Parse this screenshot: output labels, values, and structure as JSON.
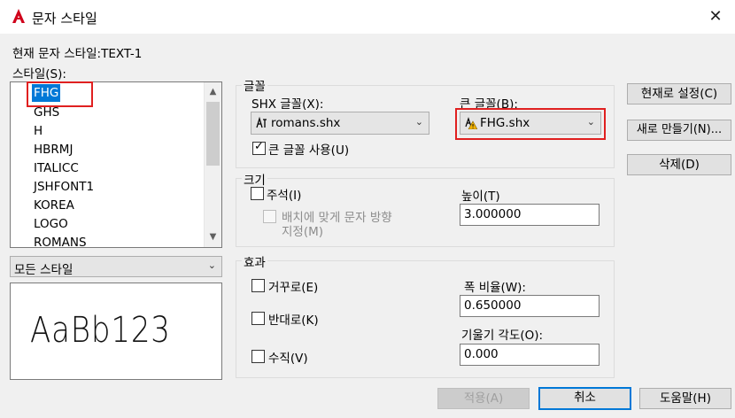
{
  "window": {
    "title": "문자 스타일",
    "close_symbol": "✕"
  },
  "current_style": {
    "label": "현재 문자 스타일:",
    "value": "TEXT-1",
    "text": "현재 문자 스타일:TEXT-1"
  },
  "styles": {
    "label": "스타일(S):",
    "items": [
      "FHG",
      "GHS",
      "H",
      "HBRMJ",
      "ITALICC",
      "JSHFONT1",
      "KOREA",
      "LOGO",
      "ROMANS"
    ],
    "selected": "FHG"
  },
  "filter": {
    "value": "모든 스타일"
  },
  "preview": {
    "text": "AaBb123"
  },
  "font_group": {
    "title": "글꼴",
    "shx_label": "SHX 글꼴(X):",
    "shx_value": "romans.shx",
    "big_label": "큰 글꼴(B):",
    "big_value": "FHG.shx",
    "use_big_font": {
      "label": "큰 글꼴 사용(U)",
      "checked": true
    }
  },
  "size_group": {
    "title": "크기",
    "annotative": {
      "label": "주석(I)",
      "checked": false
    },
    "match_orientation": {
      "label_line1": "배치에 맞게 문자 방향",
      "label_line2": "지정(M)",
      "checked": false
    },
    "height_label": "높이(T)",
    "height_value": "3.000000"
  },
  "effects_group": {
    "title": "효과",
    "upside_down": {
      "label": "거꾸로(E)",
      "checked": false
    },
    "backwards": {
      "label": "반대로(K)",
      "checked": false
    },
    "vertical": {
      "label": "수직(V)",
      "checked": false
    },
    "width_label": "폭 비율(W):",
    "width_value": "0.650000",
    "oblique_label": "기울기 각도(O):",
    "oblique_value": "0.000"
  },
  "buttons": {
    "set_current": "현재로 설정(C)",
    "new": "새로 만들기(N)...",
    "delete": "삭제(D)",
    "apply": "적용(A)",
    "cancel": "취소",
    "help": "도움말(H)"
  },
  "colors": {
    "selection": "#0078d7",
    "highlight_box": "#e02020",
    "default_button_border": "#0078d7",
    "warning": "#f2b400"
  }
}
